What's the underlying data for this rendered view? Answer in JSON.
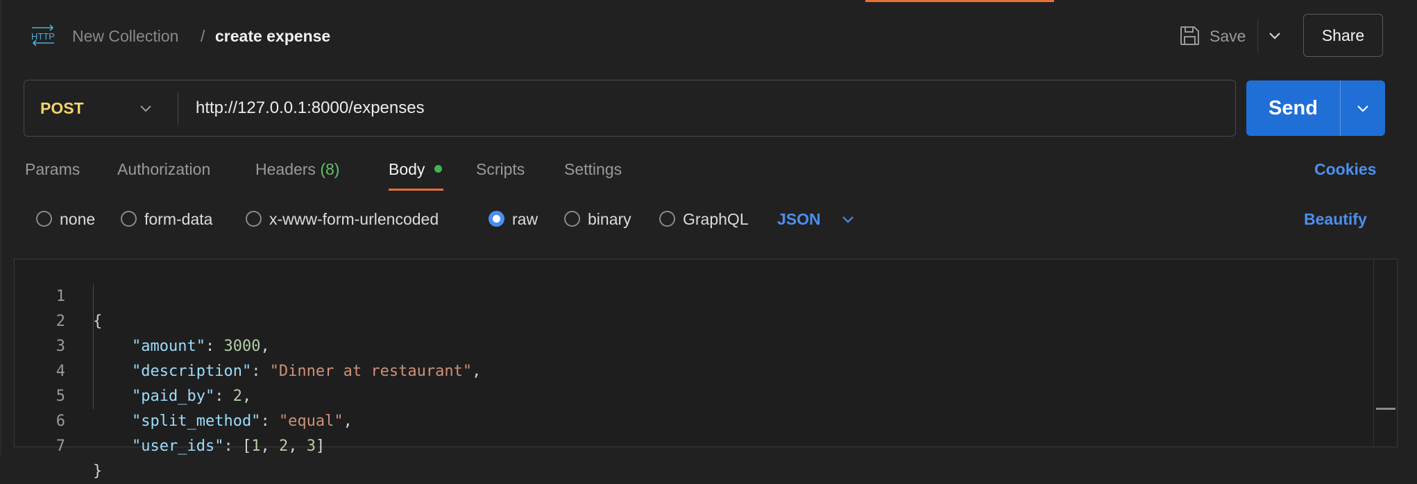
{
  "header": {
    "breadcrumb_parent": "New Collection",
    "breadcrumb_separator": "/",
    "request_name": "create expense",
    "save_label": "Save",
    "share_label": "Share"
  },
  "request": {
    "method": "POST",
    "url": "http://127.0.0.1:8000/expenses",
    "send_label": "Send"
  },
  "tabs": [
    {
      "label": "Params"
    },
    {
      "label": "Authorization"
    },
    {
      "label": "Headers",
      "count": "(8)"
    },
    {
      "label": "Body",
      "active": true
    },
    {
      "label": "Scripts"
    },
    {
      "label": "Settings"
    }
  ],
  "cookies_label": "Cookies",
  "body_types": [
    {
      "label": "none",
      "selected": false
    },
    {
      "label": "form-data",
      "selected": false
    },
    {
      "label": "x-www-form-urlencoded",
      "selected": false
    },
    {
      "label": "raw",
      "selected": true
    },
    {
      "label": "binary",
      "selected": false
    },
    {
      "label": "GraphQL",
      "selected": false
    }
  ],
  "raw_format": "JSON",
  "beautify_label": "Beautify",
  "editor": {
    "line_numbers": [
      "1",
      "2",
      "3",
      "4",
      "5",
      "6",
      "7"
    ],
    "lines": [
      {
        "open": "{"
      },
      {
        "key": "\"amount\"",
        "value": "3000",
        "type": "number",
        "trail": ","
      },
      {
        "key": "\"description\"",
        "value": "\"Dinner at restaurant\"",
        "type": "string",
        "trail": ","
      },
      {
        "key": "\"paid_by\"",
        "value": "2",
        "type": "number",
        "trail": ","
      },
      {
        "key": "\"split_method\"",
        "value": "\"equal\"",
        "type": "string",
        "trail": ","
      },
      {
        "key": "\"user_ids\"",
        "array": [
          "1",
          "2",
          "3"
        ]
      },
      {
        "close": "}"
      }
    ]
  },
  "colors": {
    "accent_orange": "#e8703a",
    "send_blue": "#1f6fd7",
    "link_blue": "#4b8ff0",
    "method_yellow": "#f3d46d",
    "json_key": "#9cdcfe",
    "json_string": "#ce9178",
    "json_number": "#b5cea8"
  },
  "icons": {
    "http": "http-icon",
    "save": "floppy-disk-icon",
    "chevron": "chevron-down-icon"
  }
}
